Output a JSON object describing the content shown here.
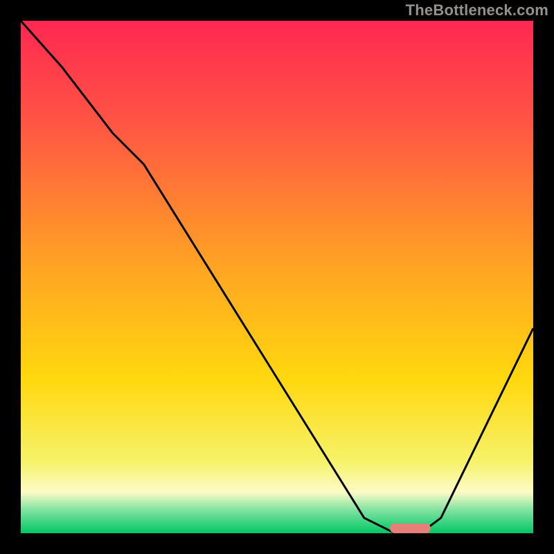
{
  "watermark": "TheBottleneck.com",
  "chart_data": {
    "type": "line",
    "title": "",
    "xlabel": "",
    "ylabel": "",
    "xlim": [
      0,
      100
    ],
    "ylim": [
      0,
      100
    ],
    "background_gradient_stops": [
      {
        "offset": 0.0,
        "color": "#ff2851"
      },
      {
        "offset": 0.2,
        "color": "#ff5544"
      },
      {
        "offset": 0.48,
        "color": "#ffa423"
      },
      {
        "offset": 0.7,
        "color": "#ffd80e"
      },
      {
        "offset": 0.86,
        "color": "#f6f26a"
      },
      {
        "offset": 0.92,
        "color": "#fcfbc6"
      },
      {
        "offset": 0.955,
        "color": "#7fe2a0"
      },
      {
        "offset": 1.0,
        "color": "#00c765"
      }
    ],
    "series": [
      {
        "name": "bottleneck-curve",
        "x": [
          0,
          8,
          18,
          24,
          67,
          73,
          78,
          82,
          100
        ],
        "y": [
          100,
          91,
          78,
          72,
          3,
          0,
          0,
          3,
          40
        ]
      }
    ],
    "marker": {
      "name": "optimal-zone",
      "x_start": 72,
      "x_end": 80,
      "y": 0.5,
      "color": "#e77f79"
    }
  }
}
